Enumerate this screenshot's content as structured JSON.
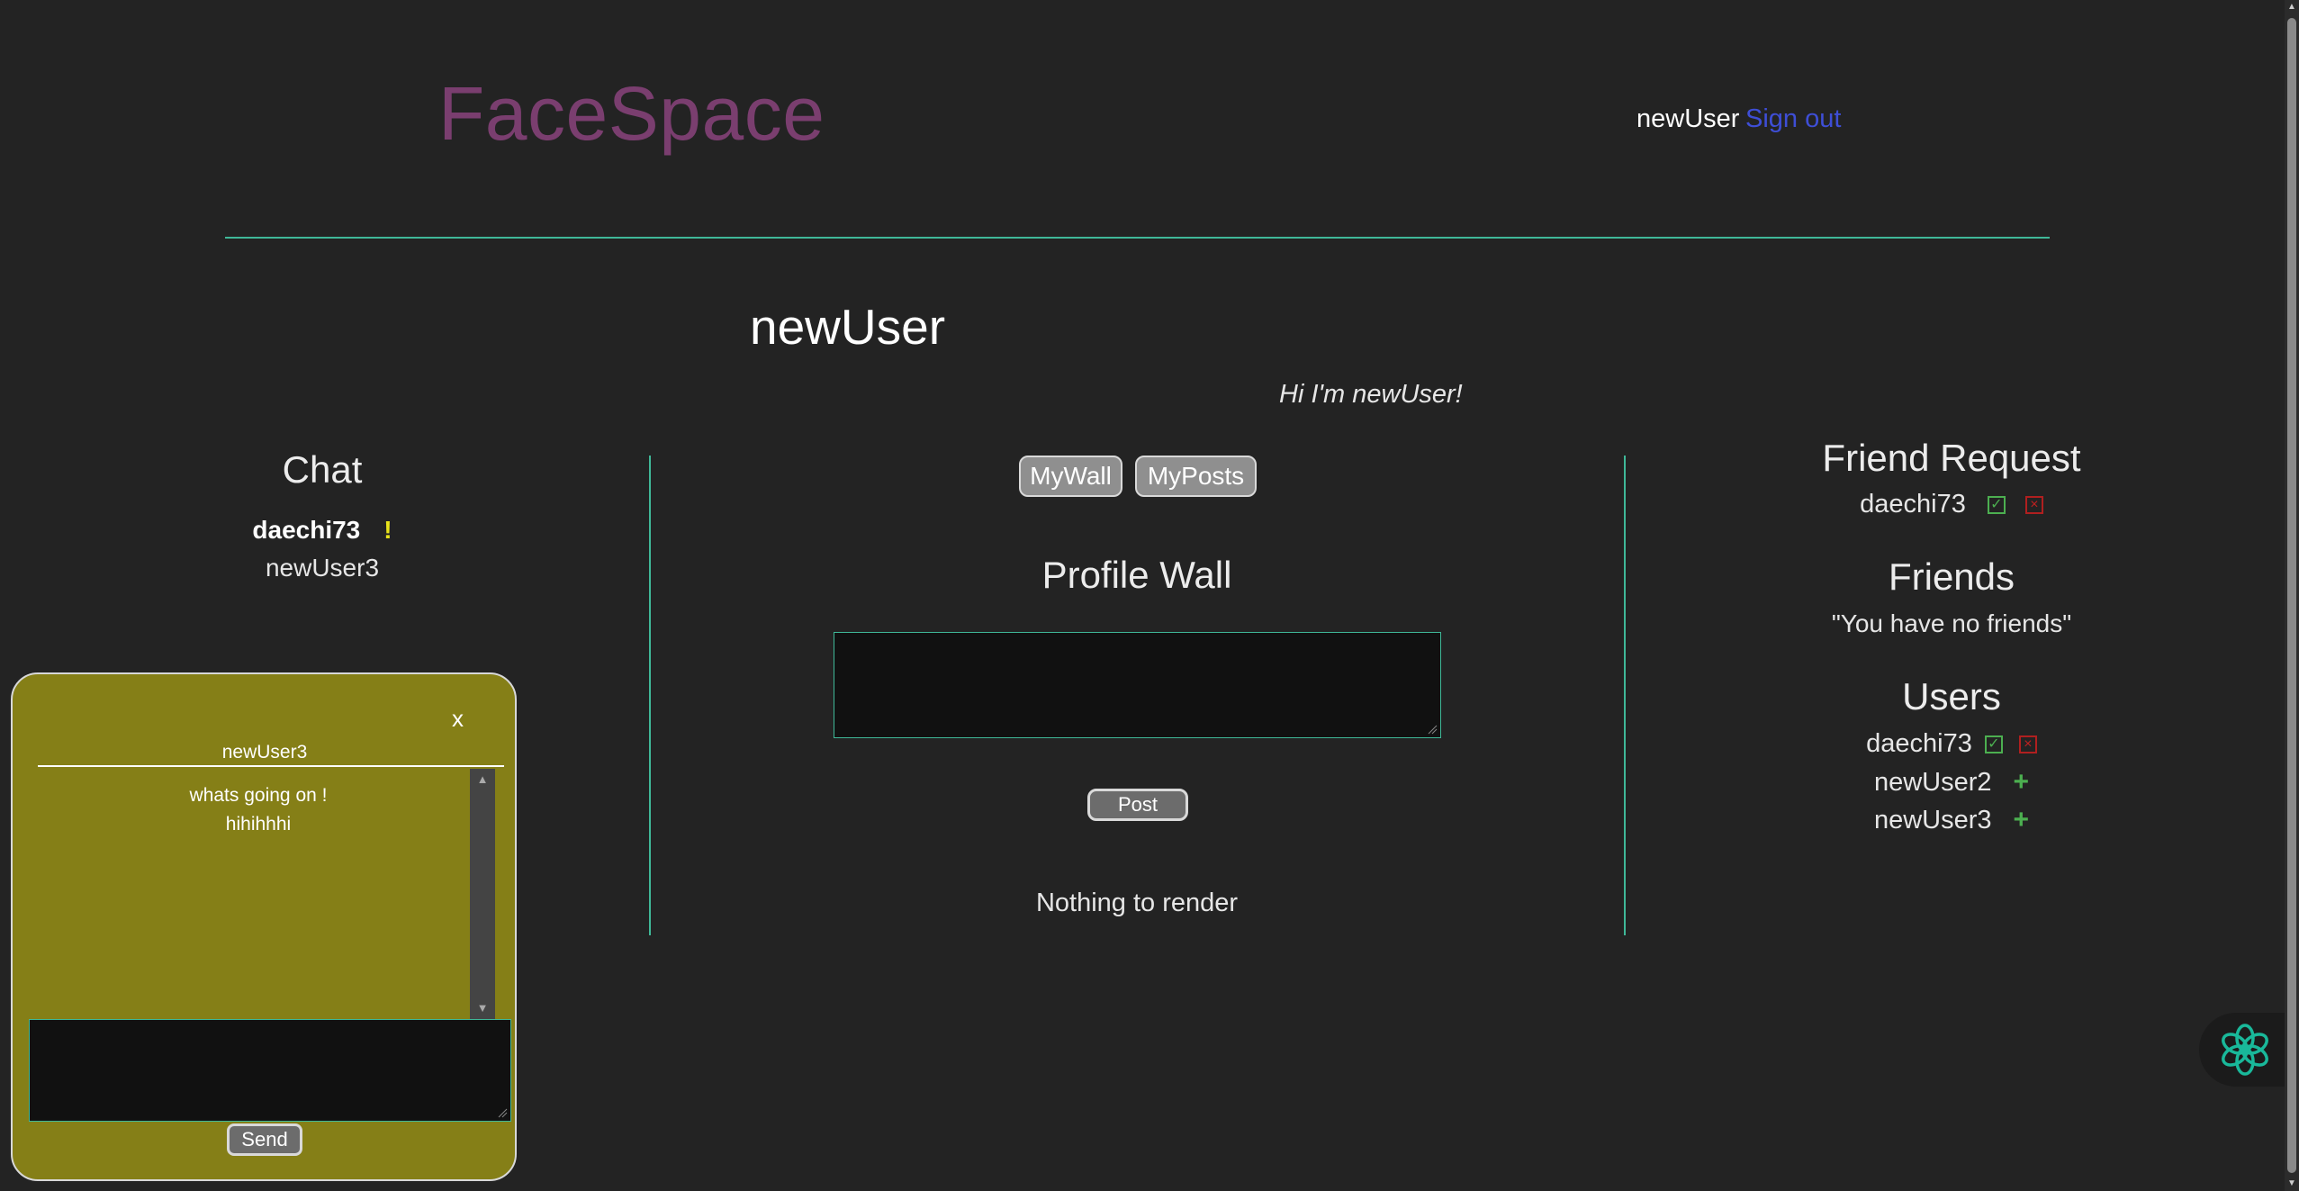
{
  "header": {
    "brand": "FaceSpace",
    "current_user": "newUser",
    "sign_out_label": "Sign out"
  },
  "profile": {
    "name": "newUser",
    "bio": "Hi I'm newUser!"
  },
  "chat_sidebar": {
    "title": "Chat",
    "contacts": [
      {
        "name": "daechi73",
        "unread": true,
        "alert_icon": "!"
      },
      {
        "name": "newUser3",
        "unread": false
      }
    ]
  },
  "wall": {
    "tabs": [
      {
        "label": "MyWall"
      },
      {
        "label": "MyPosts"
      }
    ],
    "title": "Profile Wall",
    "input_value": "",
    "post_label": "Post",
    "empty_text": "Nothing to render"
  },
  "friend_requests": {
    "title": "Friend Request",
    "items": [
      {
        "name": "daechi73",
        "accept_icon": "checkbox-check-icon",
        "reject_icon": "checkbox-x-icon"
      }
    ]
  },
  "friends": {
    "title": "Friends",
    "empty_text": "\"You have no friends\""
  },
  "users": {
    "title": "Users",
    "items": [
      {
        "name": "daechi73",
        "actions": [
          "accept",
          "reject"
        ]
      },
      {
        "name": "newUser2",
        "actions": [
          "add"
        ],
        "add_label": "+"
      },
      {
        "name": "newUser3",
        "actions": [
          "add"
        ],
        "add_label": "+"
      }
    ]
  },
  "chat_window": {
    "close_label": "x",
    "recipient": "newUser3",
    "messages": [
      {
        "text": "whats going on !"
      },
      {
        "text": "hihihhhi"
      }
    ],
    "input_value": "",
    "send_label": "Send"
  },
  "colors": {
    "background": "#232323",
    "brand": "#7a3e6f",
    "link": "#3e4ed6",
    "divider": "#3fb898",
    "chat_window_bg": "#857f17",
    "alert": "#e8e31b",
    "accept": "#4caf50",
    "reject": "#c02020"
  },
  "icons": {
    "assistant": "assistant-flower-icon"
  }
}
